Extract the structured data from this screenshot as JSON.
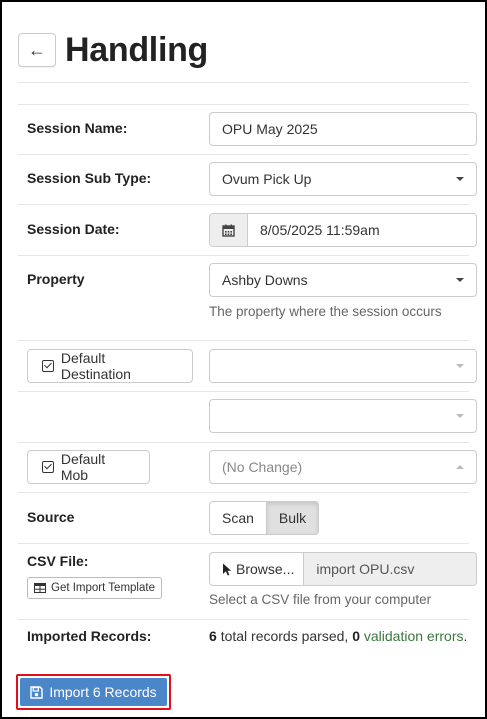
{
  "header": {
    "title": "Handling",
    "back_icon": "arrow-left-icon"
  },
  "form": {
    "session_name": {
      "label": "Session Name:",
      "value": "OPU May 2025"
    },
    "session_sub_type": {
      "label": "Session Sub Type:",
      "value": "Ovum Pick Up"
    },
    "session_date": {
      "label": "Session Date:",
      "value": "8/05/2025 11:59am",
      "icon": "calendar-icon"
    },
    "property": {
      "label": "Property",
      "value": "Ashby Downs",
      "help": "The property where the session occurs"
    },
    "default_destination": {
      "button_label": "Default Destination",
      "value": ""
    },
    "extra_select": {
      "value": ""
    },
    "default_mob": {
      "button_label": "Default Mob",
      "value": "(No Change)"
    },
    "source": {
      "label": "Source",
      "options": [
        "Scan",
        "Bulk"
      ],
      "selected": "Bulk"
    },
    "csv_file": {
      "label": "CSV File:",
      "template_button": "Get Import Template",
      "browse_label": "Browse...",
      "filename": "import OPU.csv",
      "help": "Select a CSV file from your computer"
    },
    "imported_records": {
      "label": "Imported Records:",
      "total": "6",
      "total_text": "total records parsed,",
      "errors": "0",
      "errors_text": "validation errors",
      "period": "."
    }
  },
  "actions": {
    "import_label": "Import 6 Records",
    "import_icon": "save-icon"
  },
  "colors": {
    "primary": "#4a86c8",
    "highlight": "#e0101a",
    "success": "#3c763d"
  }
}
